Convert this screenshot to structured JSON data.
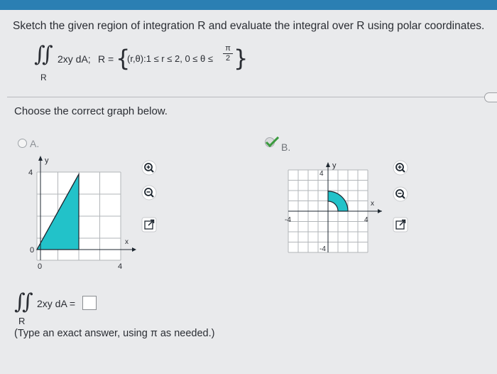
{
  "question": "Sketch the given region of integration R and evaluate the integral over R using polar coordinates.",
  "integral": {
    "integrand": "2xy dA;",
    "region_label": "R",
    "region_prefix": "R =",
    "region_set": "(r,θ):1 ≤ r ≤ 2, 0 ≤ θ ≤",
    "theta_max_num": "π",
    "theta_max_den": "2"
  },
  "prompt": "Choose the correct graph below.",
  "options": [
    {
      "label": "A.",
      "selected": false,
      "y_top_tick": "4",
      "y_zero_tick": "0",
      "x_zero_tick": "0",
      "x_right_tick": "4",
      "x_axis": "x",
      "y_axis": "y"
    },
    {
      "label": "B.",
      "selected": true,
      "y_top_tick": "4",
      "y_bottom_tick": "-4",
      "x_left_tick": "-4",
      "x_right_tick": "4",
      "x_axis": "x",
      "y_axis": "y"
    }
  ],
  "answer": {
    "integrand": "2xy dA =",
    "region_label": "R",
    "value": "",
    "hint": "(Type an exact answer, using π as needed.)"
  },
  "colors": {
    "fill": "#22c2c9",
    "accent": "#2b7fb3",
    "check": "#3a9a3e"
  },
  "icons": [
    "zoom-in-icon",
    "zoom-out-icon",
    "expand-icon"
  ]
}
